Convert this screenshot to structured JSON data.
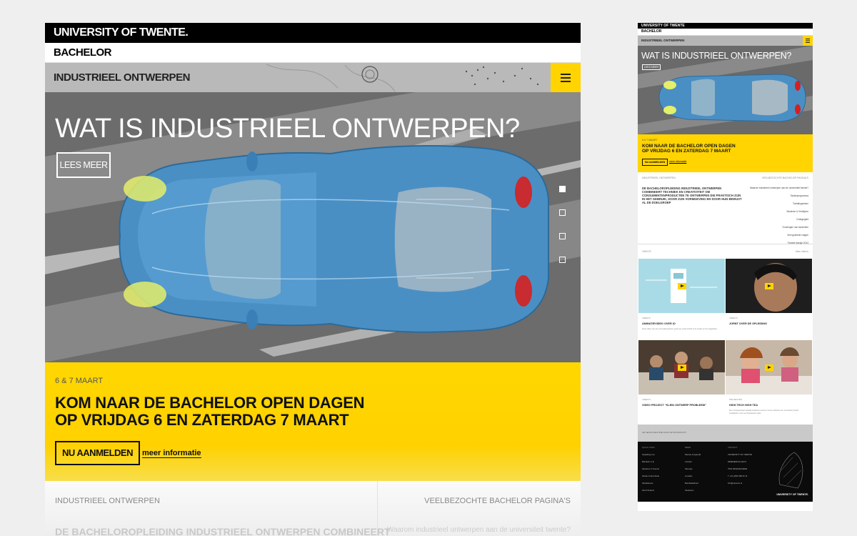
{
  "desktop": {
    "university": "UNIVERSITY OF TWENTE.",
    "level": "BACHELOR",
    "programme": "INDUSTRIEEL ONTWERPEN",
    "hero": {
      "title": "WAT IS INDUSTRIEEL ONTWERPEN?",
      "button": "LEES MEER",
      "slides_total": 4,
      "slide_active": 1
    },
    "promo": {
      "date": "6 & 7 MAART",
      "title_line1": "KOM NAAR DE BACHELOR OPEN DAGEN",
      "title_line2": "OP VRIJDAG 6 EN ZATERDAG 7 MAART",
      "register": "NU AANMELDEN",
      "more": "meer informatie"
    },
    "bottom": {
      "left_label": "INDUSTRIEEL ONTWERPEN",
      "right_label": "VEELBEZOCHTE BACHELOR PAGINA'S",
      "left_text": "DE BACHELOROPLEIDING INDUSTRIEEL ONTWERPEN COMBINEERT",
      "right_text": "Waarom industrieel ontwerpen aan de universiteit twente?"
    }
  },
  "mobile": {
    "university": "UNIVERSITY OF TWENTE",
    "level": "BACHELOR",
    "programme": "INDUSTRIEEL ONTWERPEN",
    "hero": {
      "title": "WAT IS INDUSTRIEEL ONTWERPEN?",
      "button": "LEES MEER"
    },
    "promo": {
      "date": "6 & 7 MAART",
      "title_line1": "KOM NAAR DE BACHELOR OPEN DAGEN",
      "title_line2": "OP VRIJDAG 6 EN ZATERDAG 7 MAART",
      "register": "NU AANMELDEN",
      "more": "meer informatie"
    },
    "info": {
      "left_label": "INDUSTRIEEL ONTWERPEN",
      "right_label": "VEELBEZOCHTE BACHELOR PAGINA'S",
      "text": "DE BACHELOROPLEIDING INDUSTRIEEL ONTWERPEN COMBINEERT TECHNIEK EN CREATIVITEIT OM CONSUMENTENPRODUCTEN TE ONTWERPEN DIE PRAKTISCH ZIJN IN HET GEBRUIK, DOOR ZIJN VORMGEVING EN DOOR HUN BEWUST AL DE DOELGROEP",
      "links": [
        "Waarom industrieel ontwerpen aan de universiteit twente?",
        "Studieprogramma",
        "Toelatingseisen",
        "Studeren & Verblijven",
        "Collegegeld",
        "Ervaringen van studenten",
        "Veel gestelde vragen",
        "Tweede kansje 2014"
      ]
    },
    "videos_label": "VIDEO'S",
    "videos_more": "Meer video's",
    "tiles": [
      {
        "tag": "VIDEO'S",
        "title": "ANIMATIEVIDEO OVER IO",
        "text": "Deze video van een animatieprojecten geeft een goed inzicht in de studie en het vakgebied."
      },
      {
        "tag": "VIDEO'S",
        "title": "JORNT OVER DE OPLEIDING",
        "text": ""
      },
      {
        "tag": "VIDEO'S",
        "title": "VIDEO PROJECT \"KLEIN ONTWERP PROBLEEM\"",
        "text": ""
      },
      {
        "tag": "PROJECTEN",
        "title": "HIGH TECH HIGH TEA",
        "text": "Een ontwerpproject waarbij studenten samen met de industrie een innovatief product ontwikkelen voor een bestaande markt."
      }
    ],
    "strip_text": "HET ■ BACHELOR ■ NAAR DE BOVENKANT",
    "footer": {
      "col1_head": "QUICK LINKS",
      "col1": [
        "Opleiding in Ip",
        "Bachelor in Ip",
        "Studeren in Twente",
        "Studie in Enschede",
        "Studiekeuze",
        "Word Student"
      ],
      "col2_head": "MEER",
      "col2": [
        "Nieuws & Agenda",
        "Contact",
        "Sitemap",
        "Locaties",
        "Bereikbaarheid",
        "Vacatures"
      ],
      "col3_head": "CONTACT",
      "col3": [
        "UNIVERSITY OF TWENTE",
        "DRIENERLOLAAN 5",
        "7522 NB ENSCHEDE",
        "T +31 (0)53 489 91 11",
        "info@utwente.nl"
      ],
      "brand": "UNIVERSITY OF TWENTE."
    }
  }
}
